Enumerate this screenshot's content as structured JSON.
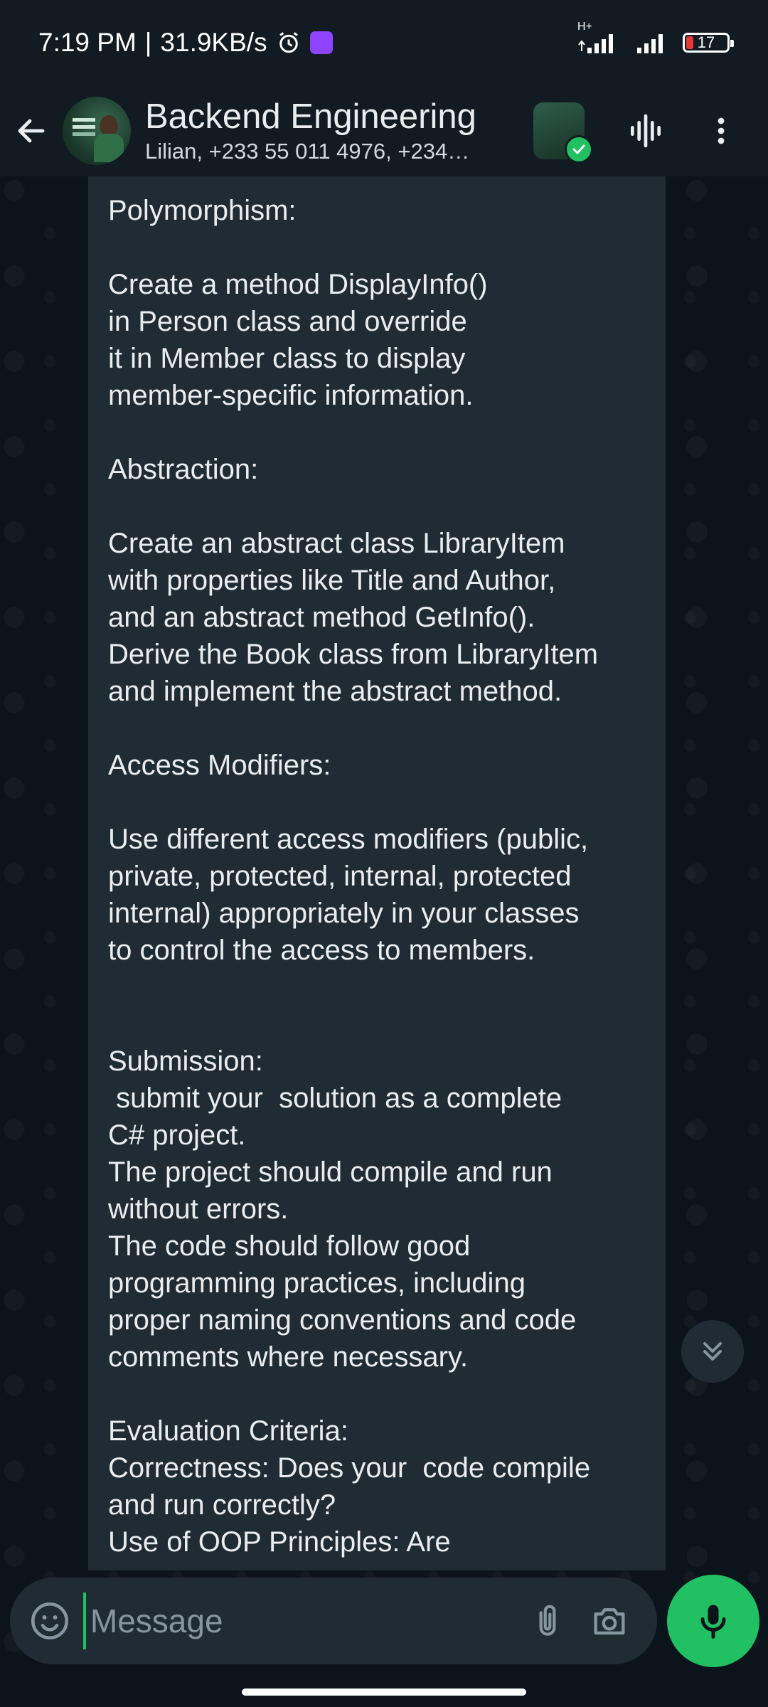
{
  "status_bar": {
    "time": "7:19 PM",
    "separator": "|",
    "network_speed": "31.9KB/s",
    "network_type": "H+",
    "battery_level": "17",
    "battery_fraction": 0.17,
    "icons": [
      "alarm-icon",
      "app-notification-icon",
      "signal-icon",
      "signal-icon",
      "battery-icon"
    ]
  },
  "header": {
    "title": "Backend Engineering",
    "subtitle": "Lilian, +233 55 011 4976, +234…",
    "icons": [
      "back-arrow-icon",
      "group-avatar",
      "community-icon",
      "voice-call-icon",
      "more-options-icon"
    ]
  },
  "message": {
    "text": "Polymorphism:\n\nCreate a method DisplayInfo()\nin Person class and override\nit in Member class to display\nmember-specific information.\n\nAbstraction:\n\nCreate an abstract class LibraryItem\nwith properties like Title and Author,\nand an abstract method GetInfo().\nDerive the Book class from LibraryItem\nand implement the abstract method.\n\nAccess Modifiers:\n\nUse different access modifiers (public,\nprivate, protected, internal, protected\ninternal) appropriately in your classes\nto control the access to members.\n\n\nSubmission:\n submit your  solution as a complete\nC# project.\nThe project should compile and run\nwithout errors.\nThe code should follow good\nprogramming practices, including\nproper naming conventions and code\ncomments where necessary.\n\nEvaluation Criteria:\nCorrectness: Does your  code compile\nand run correctly?\nUse of OOP Principles: Are"
  },
  "composer": {
    "placeholder": "Message",
    "value": "",
    "icons": [
      "emoji-icon",
      "attach-icon",
      "camera-icon",
      "mic-icon",
      "scroll-down-icon"
    ]
  },
  "colors": {
    "background": "#0b141a",
    "header": "#111b21",
    "bubble": "#202c33",
    "accent": "#21c063",
    "text": "#e9edef",
    "muted": "#8696a0"
  }
}
